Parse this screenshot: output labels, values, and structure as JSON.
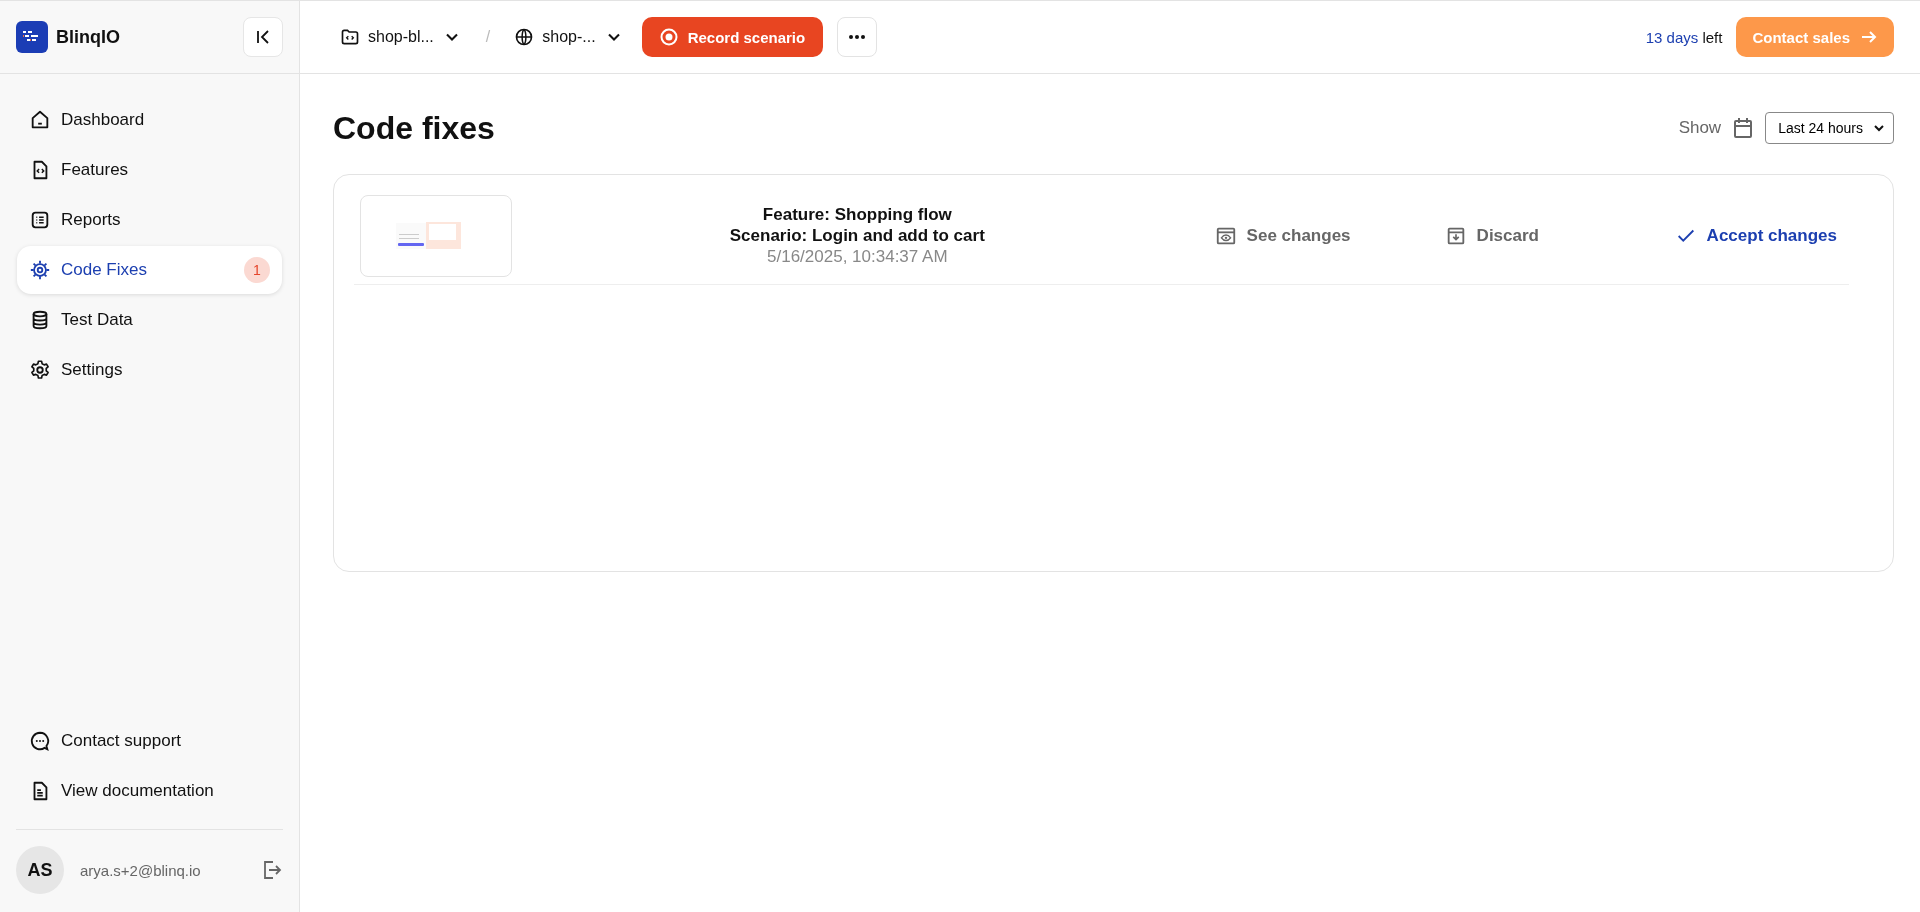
{
  "brand": {
    "name": "BlinqIO"
  },
  "sidebar": {
    "items": [
      {
        "label": "Dashboard",
        "selected": false
      },
      {
        "label": "Features",
        "selected": false
      },
      {
        "label": "Reports",
        "selected": false
      },
      {
        "label": "Code Fixes",
        "selected": true,
        "badge": "1"
      },
      {
        "label": "Test Data",
        "selected": false
      },
      {
        "label": "Settings",
        "selected": false
      }
    ],
    "footer_items": [
      {
        "label": "Contact support"
      },
      {
        "label": "View documentation"
      }
    ],
    "user": {
      "initials": "AS",
      "email": "arya.s+2@blinq.io"
    }
  },
  "topbar": {
    "project": "shop-bl...",
    "environment": "shop-...",
    "separator": "/",
    "record_button": "Record scenario",
    "trial_count": "13 days",
    "trial_suffix": "left",
    "contact_button": "Contact sales"
  },
  "page": {
    "title": "Code fixes",
    "filter_label": "Show",
    "range": "Last 24 hours"
  },
  "fixes": [
    {
      "feature": "Feature: Shopping flow",
      "scenario": "Scenario: Login and add to cart",
      "timestamp": "5/16/2025, 10:34:37 AM",
      "actions": [
        "See changes",
        "Discard",
        "Accept changes"
      ]
    }
  ]
}
